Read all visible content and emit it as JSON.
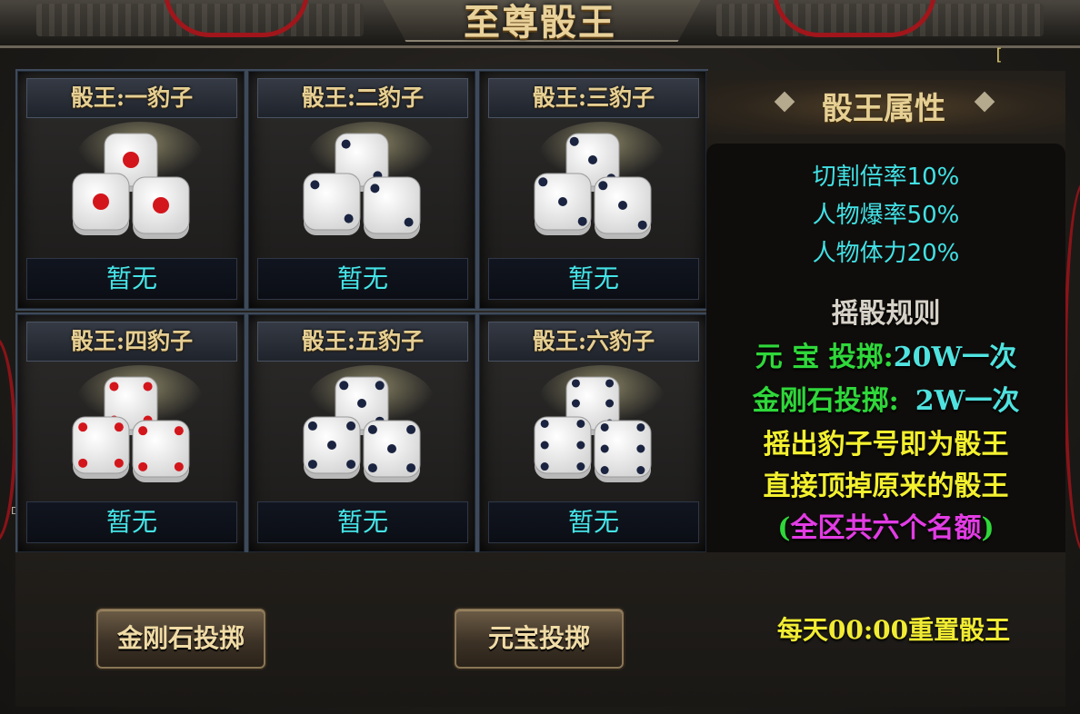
{
  "title": "至尊骰王",
  "corner_mark": "[",
  "side_letter": "D",
  "cards": [
    {
      "title": "骰王:一豹子",
      "status": "暂无",
      "face": "one"
    },
    {
      "title": "骰王:二豹子",
      "status": "暂无",
      "face": "two"
    },
    {
      "title": "骰王:三豹子",
      "status": "暂无",
      "face": "three"
    },
    {
      "title": "骰王:四豹子",
      "status": "暂无",
      "face": "four"
    },
    {
      "title": "骰王:五豹子",
      "status": "暂无",
      "face": "five"
    },
    {
      "title": "骰王:六豹子",
      "status": "暂无",
      "face": "six"
    }
  ],
  "attributes": {
    "title": "骰王属性",
    "lines": [
      "切割倍率10%",
      "人物爆率50%",
      "人物体力20%"
    ]
  },
  "rules": {
    "title": "摇骰规则",
    "yuanbao_label": "元 宝 投掷:",
    "yuanbao_value": "20W一次",
    "diamond_label": "金刚石投掷:",
    "diamond_value": "2W一次",
    "line3": "摇出豹子号即为骰王",
    "line4": "直接顶掉原来的骰王",
    "line5_open": "(",
    "line5_text": "全区共六个名额",
    "line5_close": ")"
  },
  "buttons": {
    "diamond_roll": "金刚石投掷",
    "yuanbao_roll": "元宝投掷"
  },
  "reset_note": "每天00:00重置骰王",
  "colors": {
    "status_cyan": "#45e5e8",
    "title_gold": "#e6cf93",
    "rule_green": "#2fd83a",
    "rule_yellow": "#f3f02f",
    "rule_magenta": "#e23ce4",
    "pip_red": "#d3161c",
    "pip_navy": "#1a2440"
  }
}
